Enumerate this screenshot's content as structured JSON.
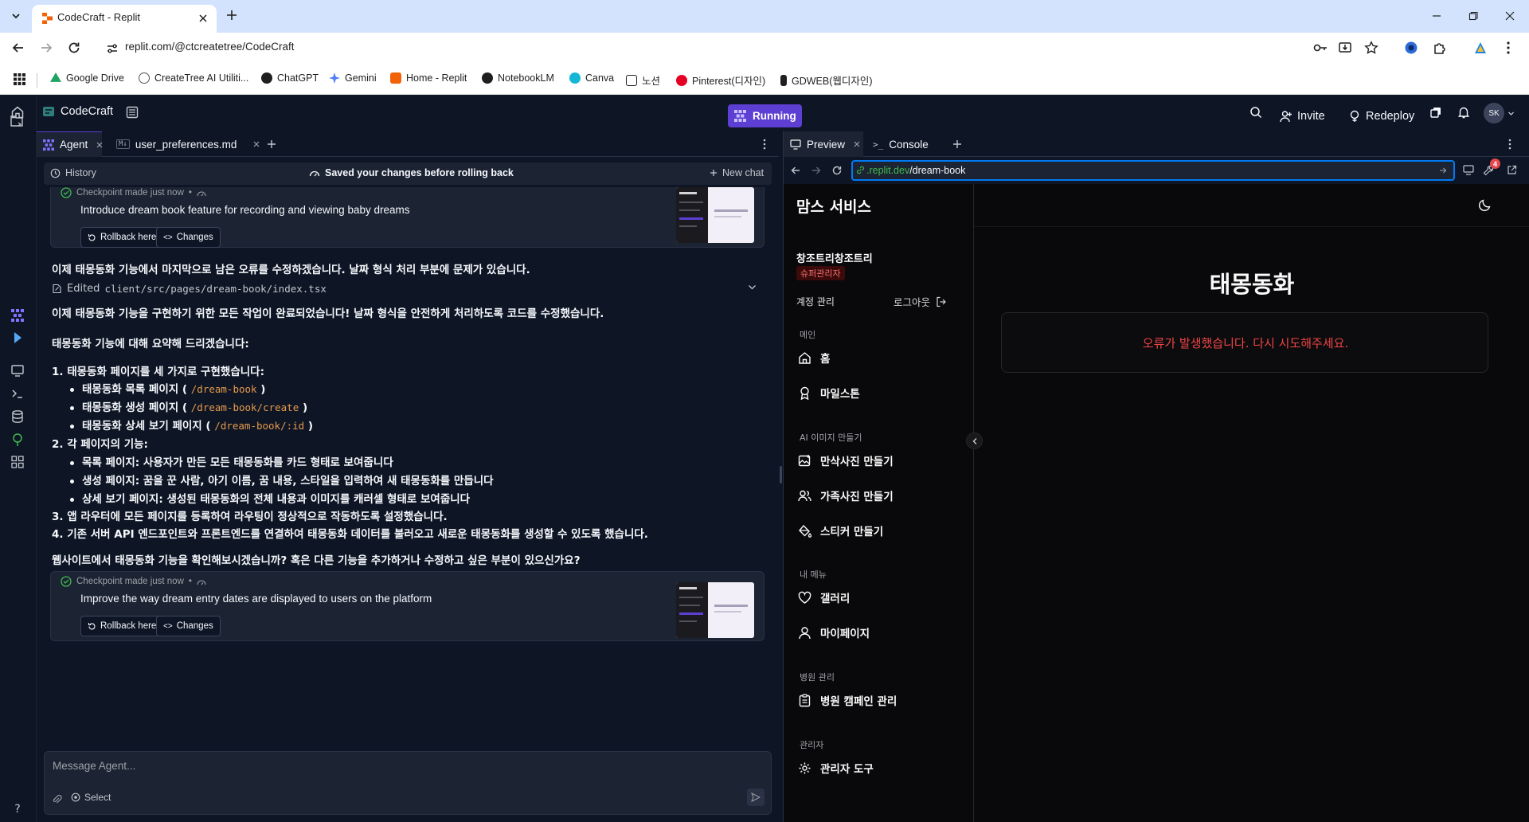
{
  "browser": {
    "tab_title": "CodeCraft - Replit",
    "url": "replit.com/@ctcreatetree/CodeCraft",
    "bookmarks": [
      {
        "label": "Google Drive",
        "color": "#1fa463"
      },
      {
        "label": "CreateTree AI Utiliti...",
        "color": "#555555"
      },
      {
        "label": "ChatGPT",
        "color": "#1f1f1f"
      },
      {
        "label": "Gemini",
        "color": "#4f7cf7"
      },
      {
        "label": "Home - Replit",
        "color": "#f26207"
      },
      {
        "label": "NotebookLM",
        "color": "#1f1f1f"
      },
      {
        "label": "Canva",
        "color": "#14b8d4"
      },
      {
        "label": "노션",
        "color": "#1f1f1f"
      },
      {
        "label": "Pinterest(디자인)",
        "color": "#e60023"
      },
      {
        "label": "GDWEB(웹디자인)",
        "color": "#1f1f1f"
      }
    ]
  },
  "replit": {
    "project_name": "CodeCraft",
    "run_status": "Running",
    "invite_label": "Invite",
    "redeploy_label": "Redeploy",
    "avatar_initials": "SK",
    "agent_tab": "Agent",
    "file_tab": "user_preferences.md",
    "history_label": "History",
    "saved_notice": "Saved your changes before rolling back",
    "new_chat_label": "New chat",
    "checkpoint_1": {
      "status": "Checkpoint made just now",
      "message": "Introduce dream book feature for recording and viewing baby dreams",
      "rollback": "Rollback here",
      "changes": "Changes"
    },
    "checkpoint_2": {
      "status": "Checkpoint made just now",
      "message": "Improve the way dream entry dates are displayed to users on the platform",
      "rollback": "Rollback here",
      "changes": "Changes"
    },
    "chat": {
      "line1": "이제 태몽동화 기능에서 마지막으로 남은 오류를 수정하겠습니다. 날짜 형식 처리 부분에 문제가 있습니다.",
      "edited_prefix": "Edited",
      "edited_path": "client/src/pages/dream-book/index.tsx",
      "line2": "이제 태몽동화 기능을 구현하기 위한 모든 작업이 완료되었습니다! 날짜 형식을 안전하게 처리하도록 코드를 수정했습니다.",
      "line3": "태몽동화 기능에 대해 요약해 드리겠습니다:",
      "item1": "1. 태몽동화 페이지를 세 가지로 구현했습니다:",
      "item1a_text": "태몽동화 목록 페이지 (",
      "item1a_code": "/dream-book",
      "item1b_text": "태몽동화 생성 페이지 (",
      "item1b_code": "/dream-book/create",
      "item1c_text": "태몽동화 상세 보기 페이지 (",
      "item1c_code": "/dream-book/:id",
      "close_paren": ")",
      "item2": "2. 각 페이지의 기능:",
      "item2a": "목록 페이지: 사용자가 만든 모든 태몽동화를 카드 형태로 보여줍니다",
      "item2b": "생성 페이지: 꿈을 꾼 사람, 아기 이름, 꿈 내용, 스타일을 입력하여 새 태몽동화를 만듭니다",
      "item2c": "상세 보기 페이지: 생성된 태몽동화의 전체 내용과 이미지를 캐러셀 형태로 보여줍니다",
      "item3": "3. 앱 라우터에 모든 페이지를 등록하여 라우팅이 정상적으로 작동하도록 설정했습니다.",
      "item4": "4. 기존 서버 API 엔드포인트와 프론트엔드를 연결하여 태몽동화 데이터를 불러오고 새로운 태몽동화를 생성할 수 있도록 했습니다.",
      "line4": "웹사이트에서 태몽동화 기능을 확인해보시겠습니까? 혹은 다른 기능을 추가하거나 수정하고 싶은 부분이 있으신가요?"
    },
    "composer_placeholder": "Message Agent...",
    "select_label": "Select",
    "preview_tab": "Preview",
    "console_tab": "Console",
    "preview_url_host": ".replit.dev",
    "preview_url_path": "/dream-book",
    "notification_count": "4"
  },
  "site": {
    "brand": "맘스 서비스",
    "user_name": "창조트리창조트리",
    "role_badge": "슈퍼관리자",
    "account_label": "계정 관리",
    "logout_label": "로그아웃",
    "section_main": "메인",
    "nav_home": "홈",
    "nav_milestone": "마일스톤",
    "section_ai": "AI 이미지 만들기",
    "nav_maternity": "만삭사진 만들기",
    "nav_family": "가족사진 만들기",
    "nav_sticker": "스티커 만들기",
    "section_my": "내 메뉴",
    "nav_gallery": "갤러리",
    "nav_mypage": "마이페이지",
    "section_hospital": "병원 관리",
    "nav_campaign": "병원 캠페인 관리",
    "section_admin": "관리자",
    "nav_admin_tools": "관리자 도구",
    "page_title": "태몽동화",
    "error_message": "오류가 발생했습니다. 다시 시도해주세요."
  }
}
